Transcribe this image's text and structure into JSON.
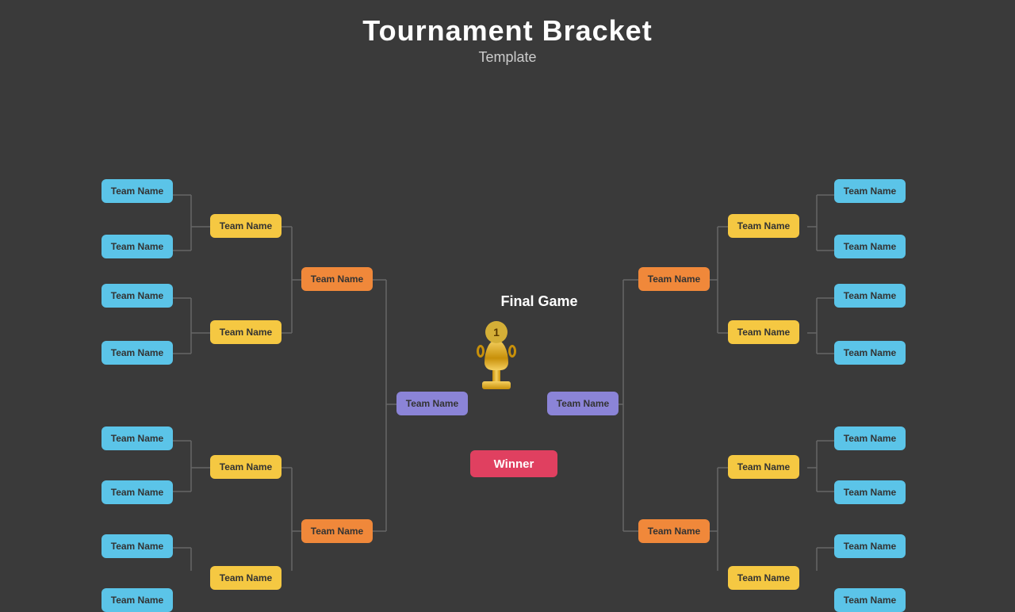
{
  "title": "Tournament Bracket",
  "subtitle": "Template",
  "final_game_label": "Final Game",
  "winner_label": "Winner",
  "trophy_number": "1",
  "teams": {
    "left_r1": [
      "Team Name",
      "Team Name",
      "Team Name",
      "Team Name",
      "Team Name",
      "Team Name",
      "Team Name",
      "Team Name"
    ],
    "left_r2": [
      "Team Name",
      "Team Name",
      "Team Name",
      "Team Name"
    ],
    "left_r3": [
      "Team Name",
      "Team Name"
    ],
    "left_final": "Team Name",
    "right_r1": [
      "Team Name",
      "Team Name",
      "Team Name",
      "Team Name",
      "Team Name",
      "Team Name",
      "Team Name",
      "Team Name"
    ],
    "right_r2": [
      "Team Name",
      "Team Name",
      "Team Name",
      "Team Name"
    ],
    "right_r3": [
      "Team Name",
      "Team Name"
    ],
    "right_final": "Team Name"
  },
  "colors": {
    "bg": "#3a3a3a",
    "blue": "#5bc4e8",
    "yellow": "#f5c842",
    "orange": "#f0883a",
    "purple": "#8b84d7",
    "red": "#e04060",
    "line": "#666666"
  }
}
